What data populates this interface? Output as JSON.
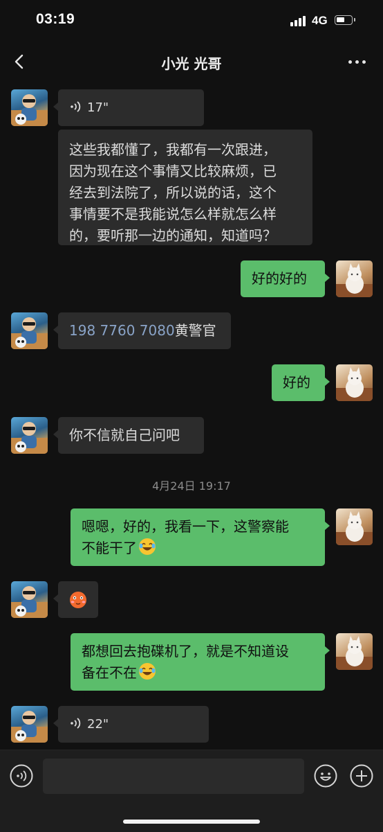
{
  "status_bar": {
    "time": "03:19",
    "network": "4G",
    "icons": [
      "signal-icon",
      "battery-icon"
    ]
  },
  "nav": {
    "title": "小光 光哥",
    "icons": [
      "back-chevron-icon",
      "more-dots-icon"
    ]
  },
  "messages": [
    {
      "sender": "other",
      "type": "voice",
      "duration": "17\""
    },
    {
      "sender": "other",
      "type": "text",
      "lines": [
        "这些我都懂了，我都有一次跟进，",
        "因为现在这个事情又比较麻烦，已",
        "经去到法院了，所以说的话，这个",
        "事情要不是我能说怎么样就怎么样",
        "的，要听那一边的通知，知道吗？"
      ]
    },
    {
      "sender": "self",
      "type": "text",
      "text": "好的好的"
    },
    {
      "sender": "other",
      "type": "text",
      "phone": "198 7760 7080",
      "suffix": "黄警官"
    },
    {
      "sender": "self",
      "type": "text",
      "text": "好的"
    },
    {
      "sender": "other",
      "type": "text",
      "text": "你不信就自己问吧"
    },
    {
      "sender": "self",
      "type": "text",
      "lines": [
        "嗯嗯，好的，我看一下，这警察能",
        "不能干了"
      ],
      "emoji": "laughing-tears-emoji"
    },
    {
      "sender": "other",
      "type": "sticker",
      "emoji": "blushing-face-emoji"
    },
    {
      "sender": "self",
      "type": "text",
      "lines": [
        "都想回去抱碟机了，就是不知道设",
        "备在不在"
      ],
      "emoji": "laughing-tears-emoji"
    },
    {
      "sender": "other",
      "type": "voice",
      "duration": "22\""
    }
  ],
  "timestamp": "4月24日 19:17",
  "input_bar": {
    "value": "",
    "icons": [
      "voice-input-icon",
      "emoji-icon",
      "plus-icon"
    ]
  },
  "colors": {
    "background": "#111111",
    "incoming_bubble": "#2c2c2c",
    "outgoing_bubble": "#5bbd6b",
    "phone_link": "#8aa4c8"
  }
}
